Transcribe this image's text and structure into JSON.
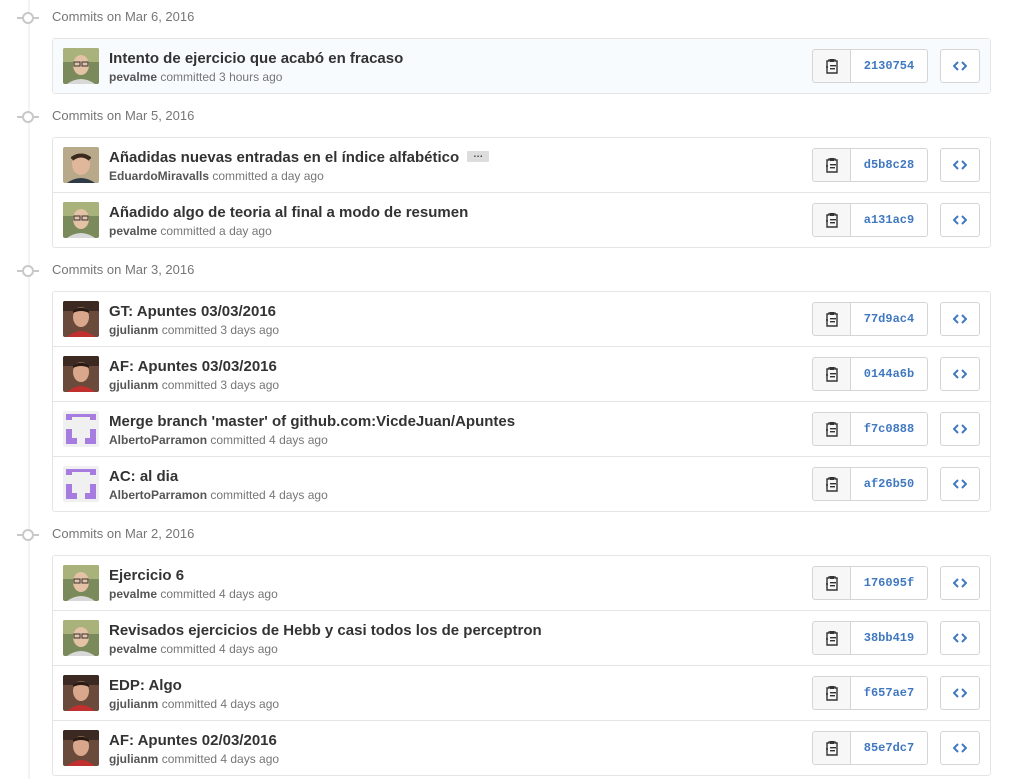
{
  "groups": [
    {
      "date_label": "Commits on Mar 6, 2016",
      "commits": [
        {
          "title": "Intento de ejercicio que acabó en fracaso",
          "author": "pevalme",
          "time": "committed 3 hours ago",
          "sha": "2130754",
          "avatar": "pevalme",
          "highlight": true
        }
      ]
    },
    {
      "date_label": "Commits on Mar 5, 2016",
      "commits": [
        {
          "title": "Añadidas nuevas entradas en el índice alfabético",
          "author": "EduardoMiravalls",
          "time": "committed a day ago",
          "sha": "d5b8c28",
          "avatar": "eduardo",
          "ellipsis": "…"
        },
        {
          "title": "Añadido algo de teoria al final a modo de resumen",
          "author": "pevalme",
          "time": "committed a day ago",
          "sha": "a131ac9",
          "avatar": "pevalme"
        }
      ]
    },
    {
      "date_label": "Commits on Mar 3, 2016",
      "commits": [
        {
          "title": "GT: Apuntes 03/03/2016",
          "author": "gjulianm",
          "time": "committed 3 days ago",
          "sha": "77d9ac4",
          "avatar": "gjulianm"
        },
        {
          "title": "AF: Apuntes 03/03/2016",
          "author": "gjulianm",
          "time": "committed 3 days ago",
          "sha": "0144a6b",
          "avatar": "gjulianm"
        },
        {
          "title": "Merge branch 'master' of github.com:VicdeJuan/Apuntes",
          "author": "AlbertoParramon",
          "time": "committed 4 days ago",
          "sha": "f7c0888",
          "avatar": "identicon"
        },
        {
          "title": "AC: al dia",
          "author": "AlbertoParramon",
          "time": "committed 4 days ago",
          "sha": "af26b50",
          "avatar": "identicon"
        }
      ]
    },
    {
      "date_label": "Commits on Mar 2, 2016",
      "commits": [
        {
          "title": "Ejercicio 6",
          "author": "pevalme",
          "time": "committed 4 days ago",
          "sha": "176095f",
          "avatar": "pevalme"
        },
        {
          "title": "Revisados ejercicios de Hebb y casi todos los de perceptron",
          "author": "pevalme",
          "time": "committed 4 days ago",
          "sha": "38bb419",
          "avatar": "pevalme"
        },
        {
          "title": "EDP: Algo",
          "author": "gjulianm",
          "time": "committed 4 days ago",
          "sha": "f657ae7",
          "avatar": "gjulianm"
        },
        {
          "title": "AF: Apuntes 02/03/2016",
          "author": "gjulianm",
          "time": "committed 4 days ago",
          "sha": "85e7dc7",
          "avatar": "gjulianm"
        }
      ]
    }
  ],
  "colors": {
    "sha_link": "#4078c0",
    "identicon": "#a77ce0",
    "highlight_row": "#f7fbfd"
  }
}
